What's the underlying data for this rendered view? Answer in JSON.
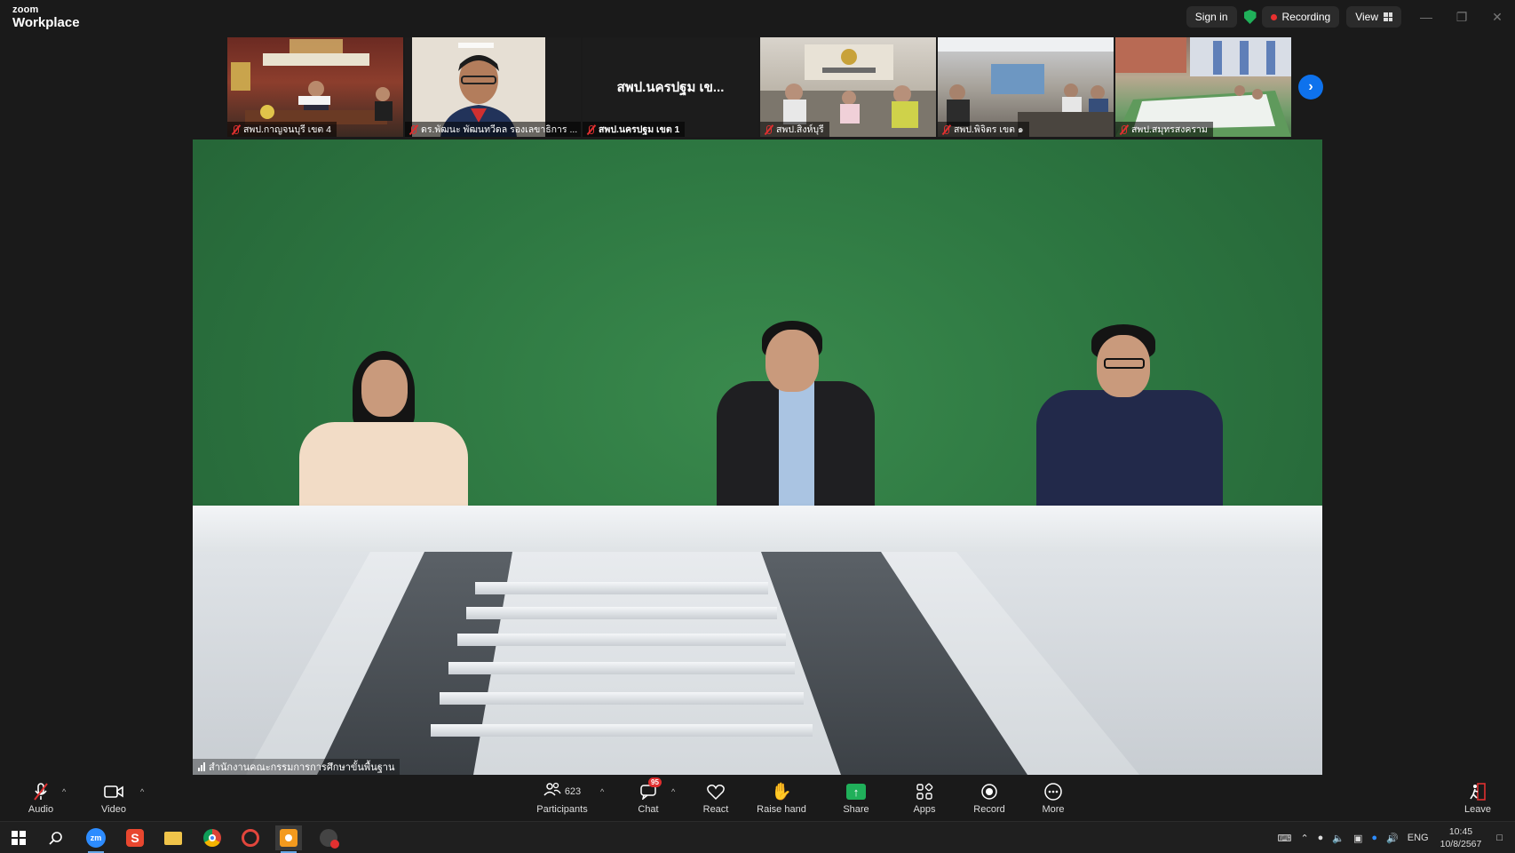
{
  "app": {
    "brand_small": "zoom",
    "brand_main": "Workplace"
  },
  "titlebar": {
    "sign_in": "Sign in",
    "recording": "Recording",
    "view": "View"
  },
  "thumbnails": [
    {
      "name": "สพป.กาญจนบุรี เขต 4",
      "muted": true,
      "scene": "a"
    },
    {
      "name": "ดร.พัฒนะ พัฒนทวีดล รองเลขาธิการ ...",
      "muted": true,
      "scene": "b"
    },
    {
      "name": "สพป.นครปฐม เขต 1",
      "muted": true,
      "scene": "card",
      "card_text": "สพป.นครปฐม เข..."
    },
    {
      "name": "สพป.สิงห์บุรี",
      "muted": true,
      "scene": "d"
    },
    {
      "name": "สพป.พิจิตร เขต ๑",
      "muted": true,
      "scene": "e"
    },
    {
      "name": "สพป.สมุทรสงคราม",
      "muted": true,
      "scene": "f"
    }
  ],
  "main_video": {
    "speaker_label": "สำนักงานคณะกรรมการการศึกษาขั้นพื้นฐาน"
  },
  "toolbar": {
    "audio": "Audio",
    "video": "Video",
    "participants": "Participants",
    "participants_count": "623",
    "chat": "Chat",
    "chat_badge": "95",
    "react": "React",
    "raise_hand": "Raise hand",
    "share": "Share",
    "apps": "Apps",
    "record": "Record",
    "more": "More",
    "leave": "Leave"
  },
  "taskbar": {
    "language": "ENG",
    "time": "10:45",
    "date": "10/8/2567"
  },
  "colors": {
    "accent": "#0e72ed",
    "share_green": "#20b05a",
    "record_red": "#e8302f"
  }
}
